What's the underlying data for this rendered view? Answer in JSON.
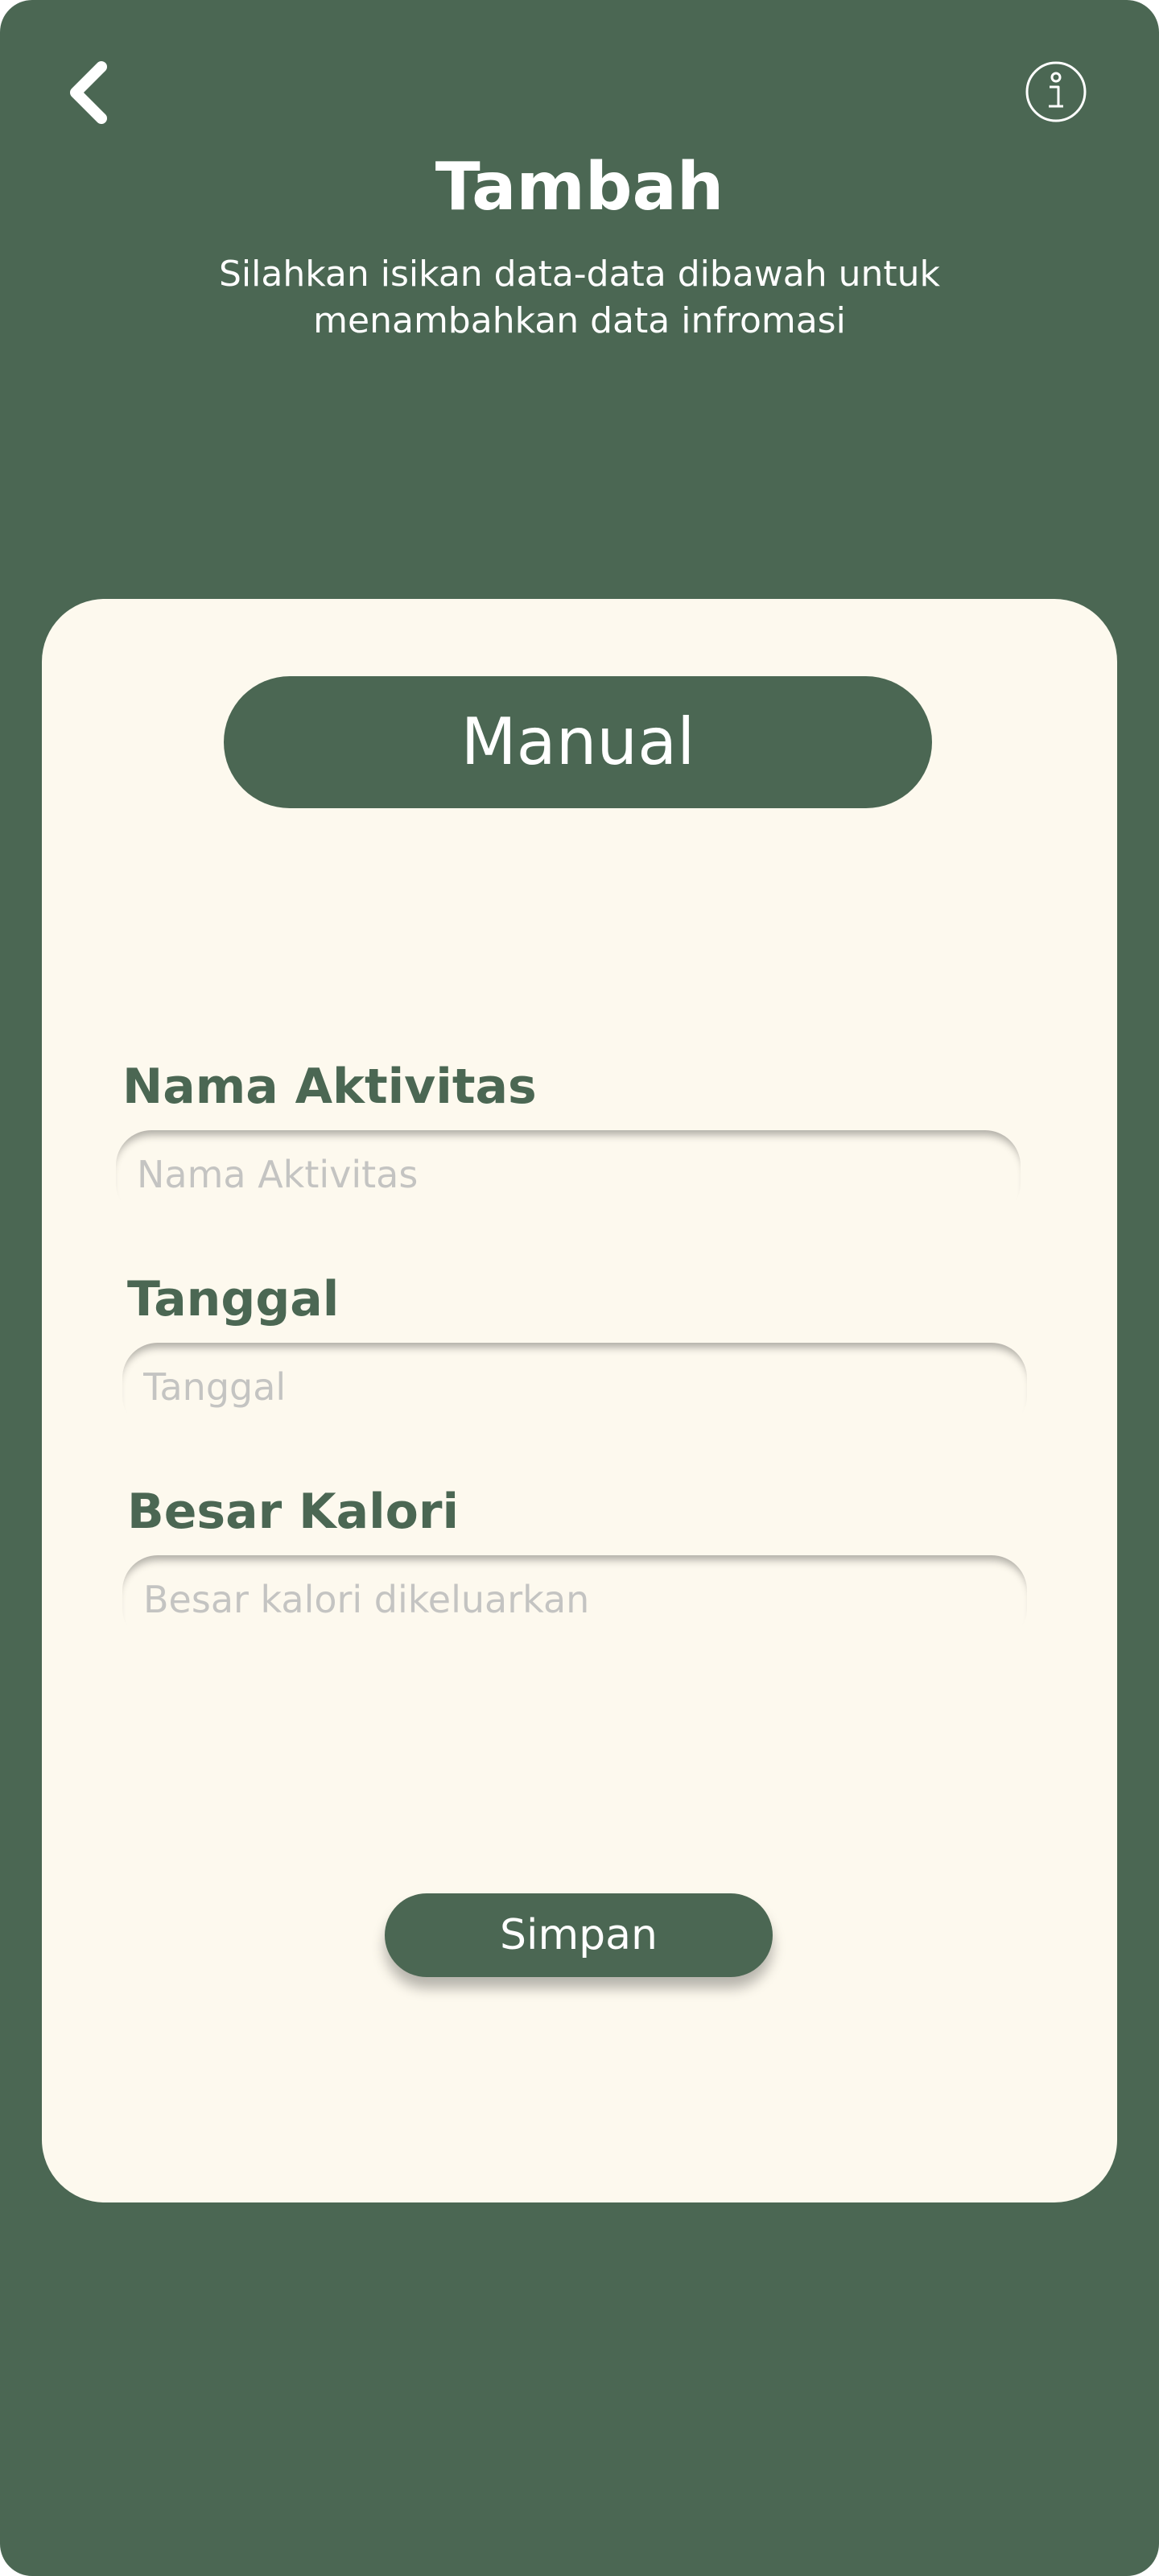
{
  "header": {
    "title": "Tambah",
    "subtitle": "Silahkan isikan data-data dibawah untuk menambahkan data infromasi",
    "back_icon": "chevron-left",
    "info_icon": "info-circle"
  },
  "form": {
    "mode_label": "Manual",
    "fields": [
      {
        "label": "Nama Aktivitas",
        "placeholder": "Nama Aktivitas",
        "value": ""
      },
      {
        "label": "Tanggal",
        "placeholder": "Tanggal",
        "value": ""
      },
      {
        "label": "Besar Kalori",
        "placeholder": "Besar kalori dikeluarkan",
        "value": ""
      }
    ],
    "save_label": "Simpan"
  },
  "colors": {
    "primary": "#4B6753",
    "card_bg": "#FDF9EE",
    "text_light": "#FFFFFF",
    "placeholder": "#C4C4C2"
  }
}
